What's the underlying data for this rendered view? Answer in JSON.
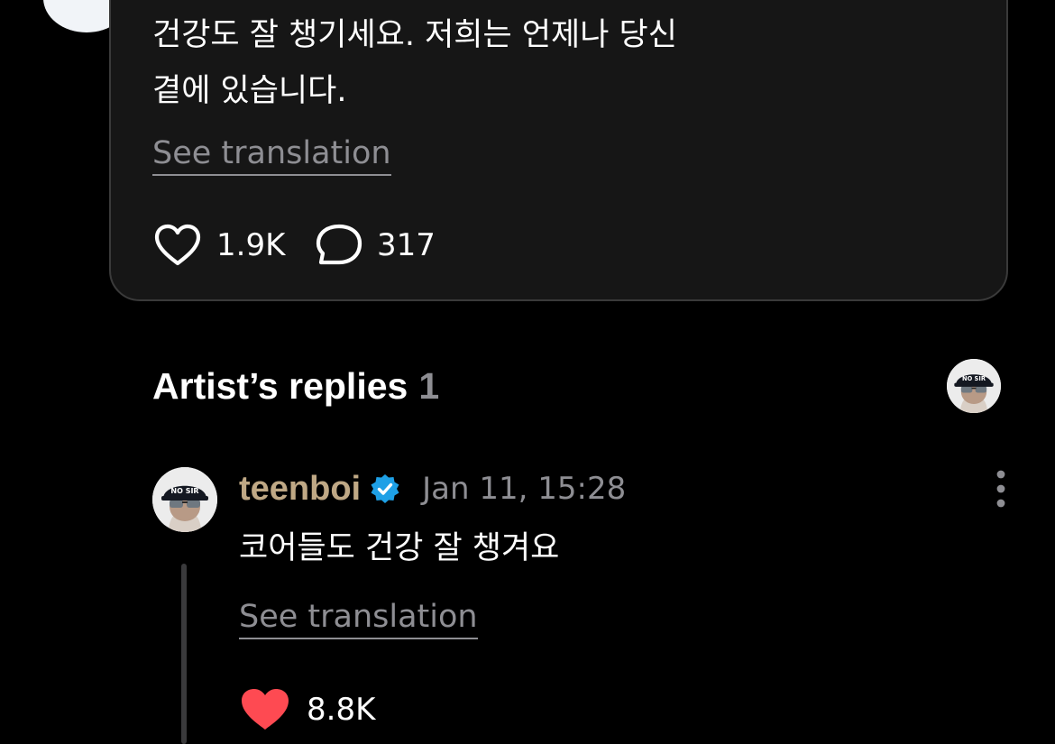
{
  "post": {
    "body_text": "건강도 잘 챙기세요. 저희는 언제나 당신\n곁에 있습니다.",
    "see_translation": "See translation",
    "likes": "1.9K",
    "comments": "317"
  },
  "artist_replies": {
    "title": "Artist’s replies",
    "count": "1",
    "avatar_icon": "no-sir-cap-avatar"
  },
  "reply": {
    "author": "teenboi",
    "verified_icon": "verified-badge-icon",
    "timestamp": "Jan 11, 15:28",
    "text": "코어들도 건강 잘 챙겨요",
    "see_translation": "See translation",
    "likes": "8.8K",
    "cap_text": "NO SIR"
  },
  "colors": {
    "background": "#000000",
    "card": "#161616",
    "author": "#bfa885",
    "verified": "#1ea0e6",
    "like_active": "#fe4a52",
    "muted": "#8e8e93"
  }
}
